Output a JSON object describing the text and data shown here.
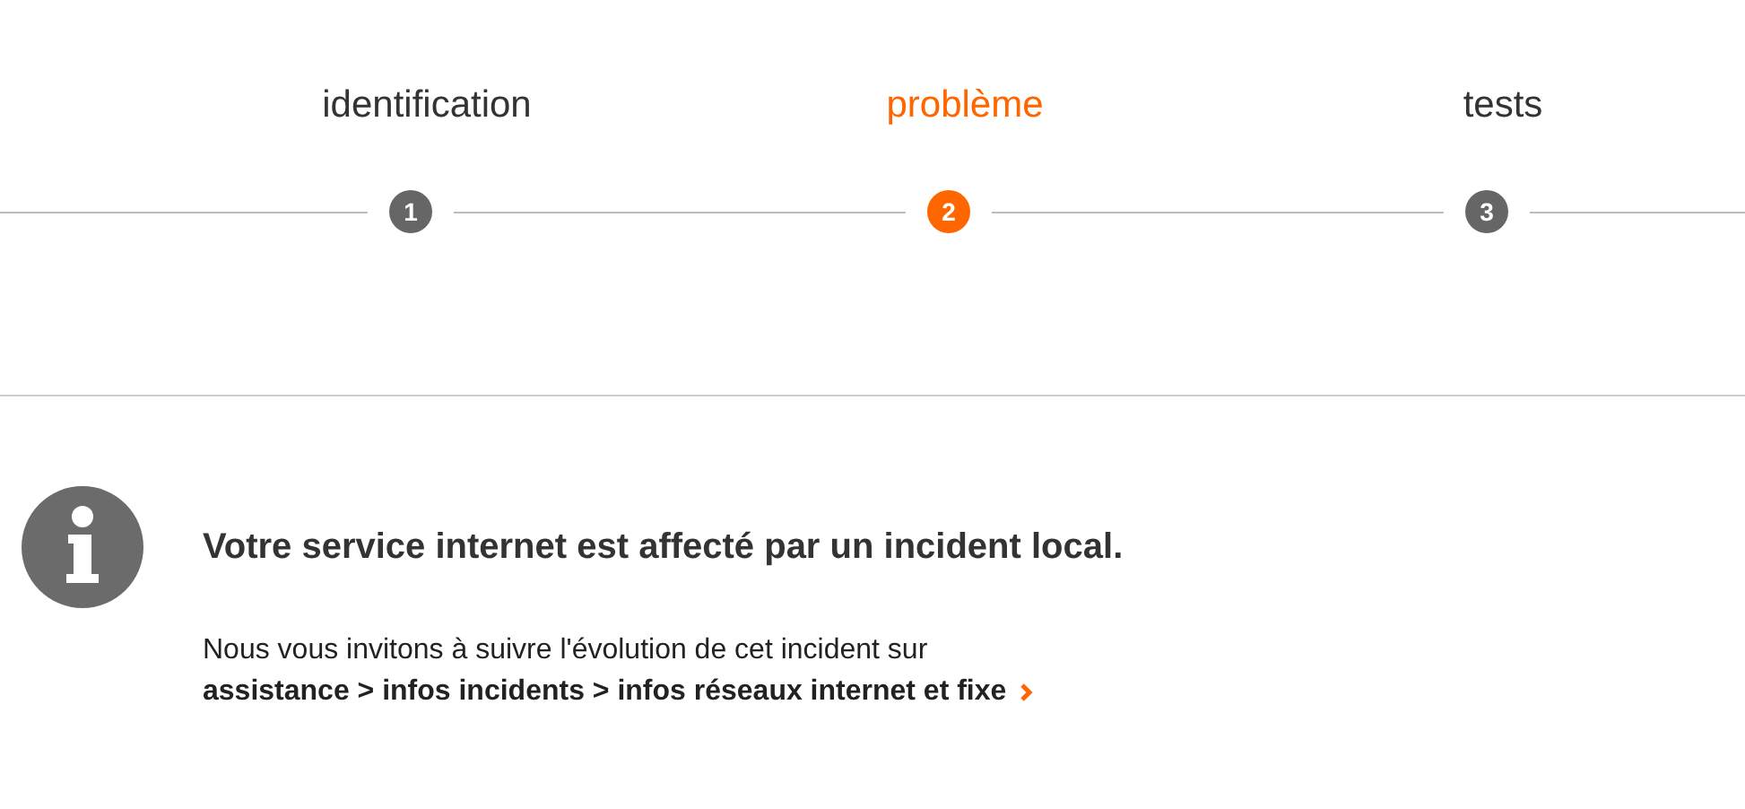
{
  "steps": [
    {
      "label": "identification",
      "number": "1",
      "selected": false
    },
    {
      "label": "problème",
      "number": "2",
      "selected": true
    },
    {
      "label": "tests",
      "number": "3",
      "selected": false
    }
  ],
  "notice": {
    "title": "Votre service internet est affecté par un incident local.",
    "text": "Nous vous invitons à suivre l'évolution de cet incident sur",
    "link": "assistance > infos incidents > infos réseaux internet et fixe"
  }
}
